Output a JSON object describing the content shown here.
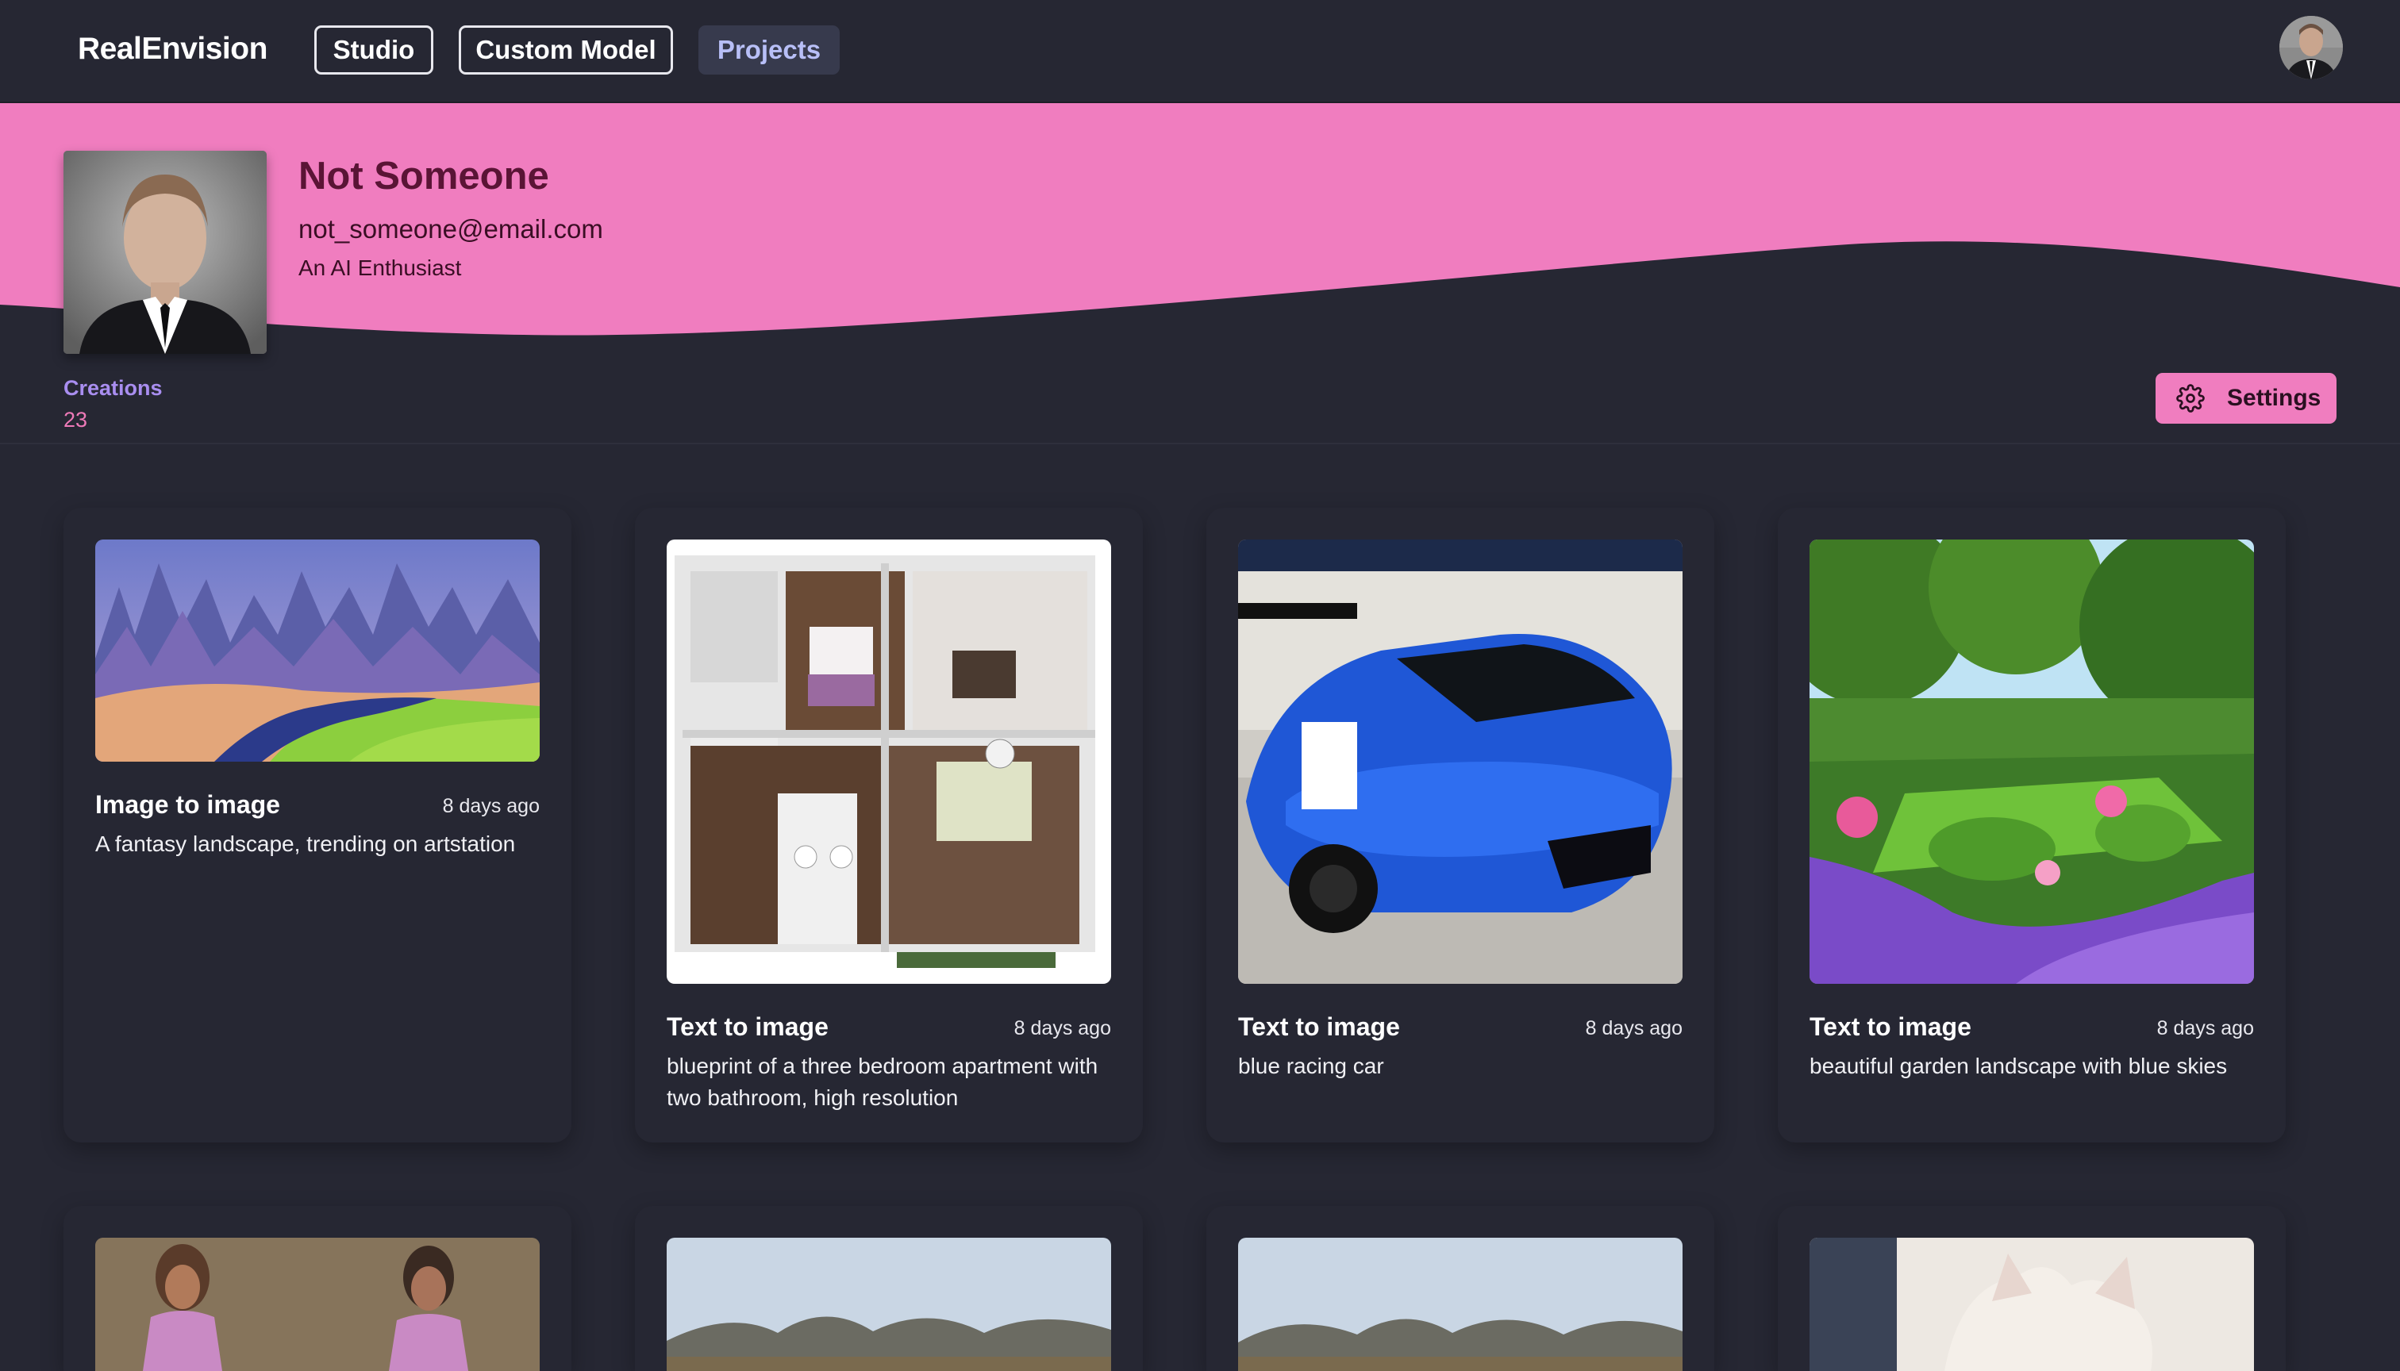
{
  "navbar": {
    "brand": "RealEnvision",
    "items": [
      {
        "label": "Studio"
      },
      {
        "label": "Custom Model"
      },
      {
        "label": "Projects"
      }
    ]
  },
  "profile": {
    "name": "Not Someone",
    "email": "not_someone@email.com",
    "bio": "An AI Enthusiast",
    "stats_label": "Creations",
    "stats_count": "23",
    "settings_label": "Settings"
  },
  "colors": {
    "page_bg": "#262733",
    "accent_pink": "#f07dbf",
    "creations_label": "#a98ef0",
    "nav_active_bg": "#373a4d"
  },
  "cards": [
    {
      "title": "Image to image",
      "time": "8 days ago",
      "desc": "A fantasy landscape, trending on artstation"
    },
    {
      "title": "Text to image",
      "time": "8 days ago",
      "desc": "blueprint of a three bedroom apartment with two bathroom, high resolution"
    },
    {
      "title": "Text to image",
      "time": "8 days ago",
      "desc": "blue racing car"
    },
    {
      "title": "Text to image",
      "time": "8 days ago",
      "desc": "beautiful garden landscape with blue skies"
    }
  ]
}
